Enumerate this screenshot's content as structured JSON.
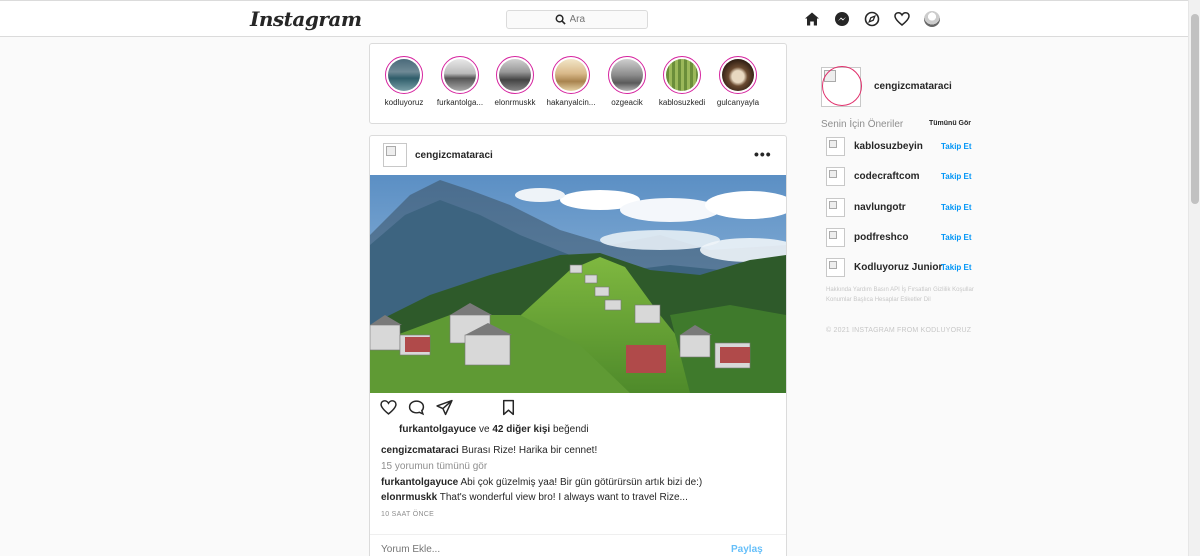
{
  "header": {
    "logo": "Instagram",
    "search_placeholder": "Ara",
    "icons": [
      "home-icon",
      "messenger-icon",
      "explore-icon",
      "heart-icon",
      "profile-avatar"
    ]
  },
  "stories": [
    {
      "name": "kodluyoruz"
    },
    {
      "name": "furkantolga..."
    },
    {
      "name": "elonrmuskk"
    },
    {
      "name": "hakanyalcin..."
    },
    {
      "name": "ozgeacik"
    },
    {
      "name": "kablosuzkedi"
    },
    {
      "name": "gulcanyayla"
    }
  ],
  "post": {
    "username": "cengizcmataraci",
    "more": "•••",
    "liked_by": "furkantolgayuce",
    "likes_mid": " ve ",
    "likes_count": "42 diğer kişi",
    "likes_end": " beğendi",
    "caption_user": "cengizcmataraci",
    "caption_text": " Burası Rize! Harika bir cennet!",
    "view_all": "15 yorumun tümünü gör",
    "comments": [
      {
        "user": "furkantolgayuce",
        "text": " Abi çok güzelmiş yaa! Bir gün götürürsün artık bizi de:)"
      },
      {
        "user": "elonrmuskk",
        "text": " That's wonderful view bro! I always want to travel Rize..."
      }
    ],
    "time": "10 SAAT ÖNCE",
    "comment_placeholder": "Yorum Ekle...",
    "share_label": "Paylaş"
  },
  "sidebar": {
    "username": "cengizcmataraci",
    "suggestions_title": "Senin İçin Öneriler",
    "see_all": "Tümünü Gör",
    "suggestions": [
      {
        "name": "kablosuzbeyin",
        "action": "Takip Et"
      },
      {
        "name": "codecraftcom",
        "action": "Takip Et"
      },
      {
        "name": "navlungotr",
        "action": "Takip Et"
      },
      {
        "name": "podfreshco",
        "action": "Takip Et"
      },
      {
        "name": "Kodluyoruz Junior",
        "action": "Takip Et"
      }
    ],
    "footer_links": "Hakkında Yardım Basın API İş Fırsatları Gizlilik Koşullar Konumlar Başlıca Hesaplar Etiketler Dil",
    "copyright": "© 2021 INSTAGRAM FROM KODLUYORUZ"
  },
  "colors": {
    "link_blue": "#0095f6",
    "story_ring": "#d6249f",
    "border": "#dbdbdb"
  }
}
